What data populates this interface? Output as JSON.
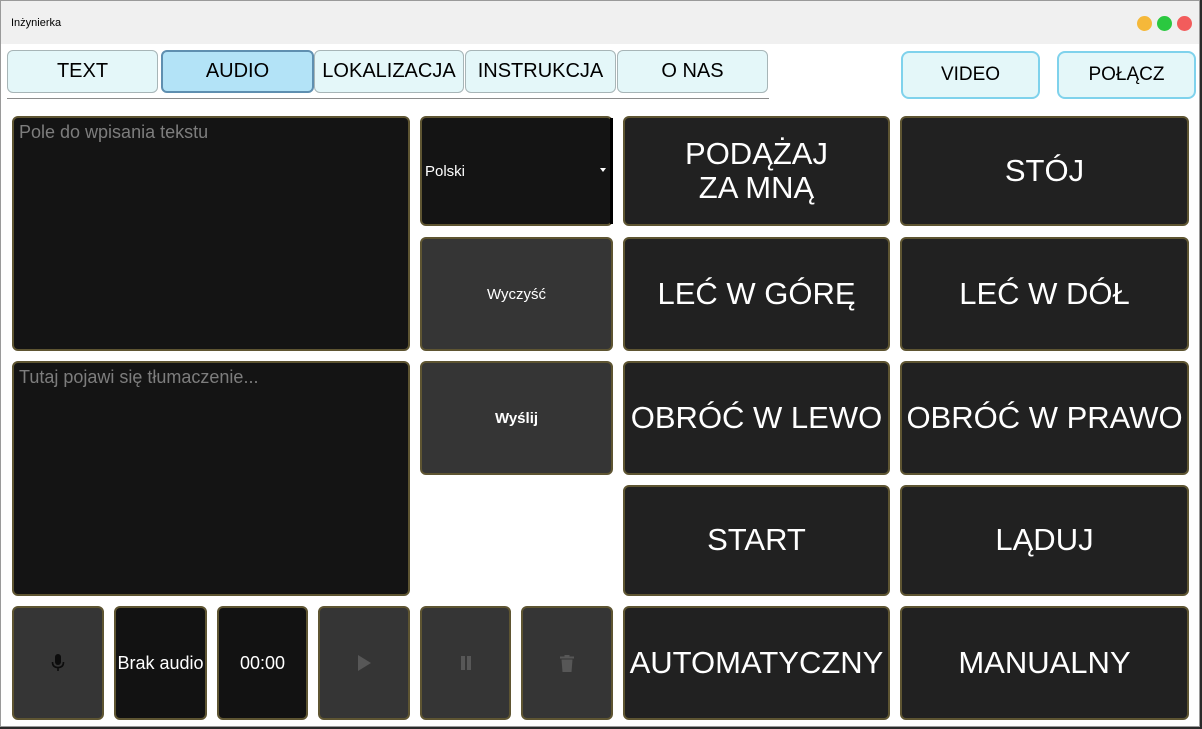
{
  "window": {
    "title": "Inżynierka"
  },
  "tabs": [
    {
      "label": "TEXT",
      "active": false
    },
    {
      "label": "AUDIO",
      "active": true
    },
    {
      "label": "LOKALIZACJA",
      "active": false
    },
    {
      "label": "INSTRUKCJA",
      "active": false
    },
    {
      "label": "O NAS",
      "active": false
    }
  ],
  "header": {
    "video_label": "VIDEO",
    "connect_label": "POŁĄCZ"
  },
  "input": {
    "placeholder": "Pole do wpisania tekstu",
    "value": ""
  },
  "output": {
    "placeholder": "Tutaj pojawi się tłumaczenie...",
    "value": ""
  },
  "language": {
    "selected": "Polski"
  },
  "actions": {
    "clear_label": "Wyczyść",
    "send_label": "Wyślij"
  },
  "commands": {
    "follow": "PODĄŻAJ\nZA MNĄ",
    "stop": "STÓJ",
    "up": "LEĆ W GÓRĘ",
    "down": "LEĆ W DÓŁ",
    "left": "OBRÓĆ W LEWO",
    "right": "OBRÓĆ W PRAWO",
    "start": "START",
    "land": "LĄDUJ",
    "auto": "AUTOMATYCZNY",
    "manual": "MANUALNY"
  },
  "audio": {
    "status": "Brak audio",
    "time": "00:00"
  },
  "colors": {
    "tab_bg": "#e4f7f9",
    "tab_active_bg": "#b3e3f7",
    "panel_bg": "#141414",
    "button_bg": "#212121",
    "border": "#5e5532"
  },
  "icons": {
    "mic": "microphone-icon",
    "play": "play-icon",
    "pause": "pause-icon",
    "delete": "trash-icon"
  }
}
